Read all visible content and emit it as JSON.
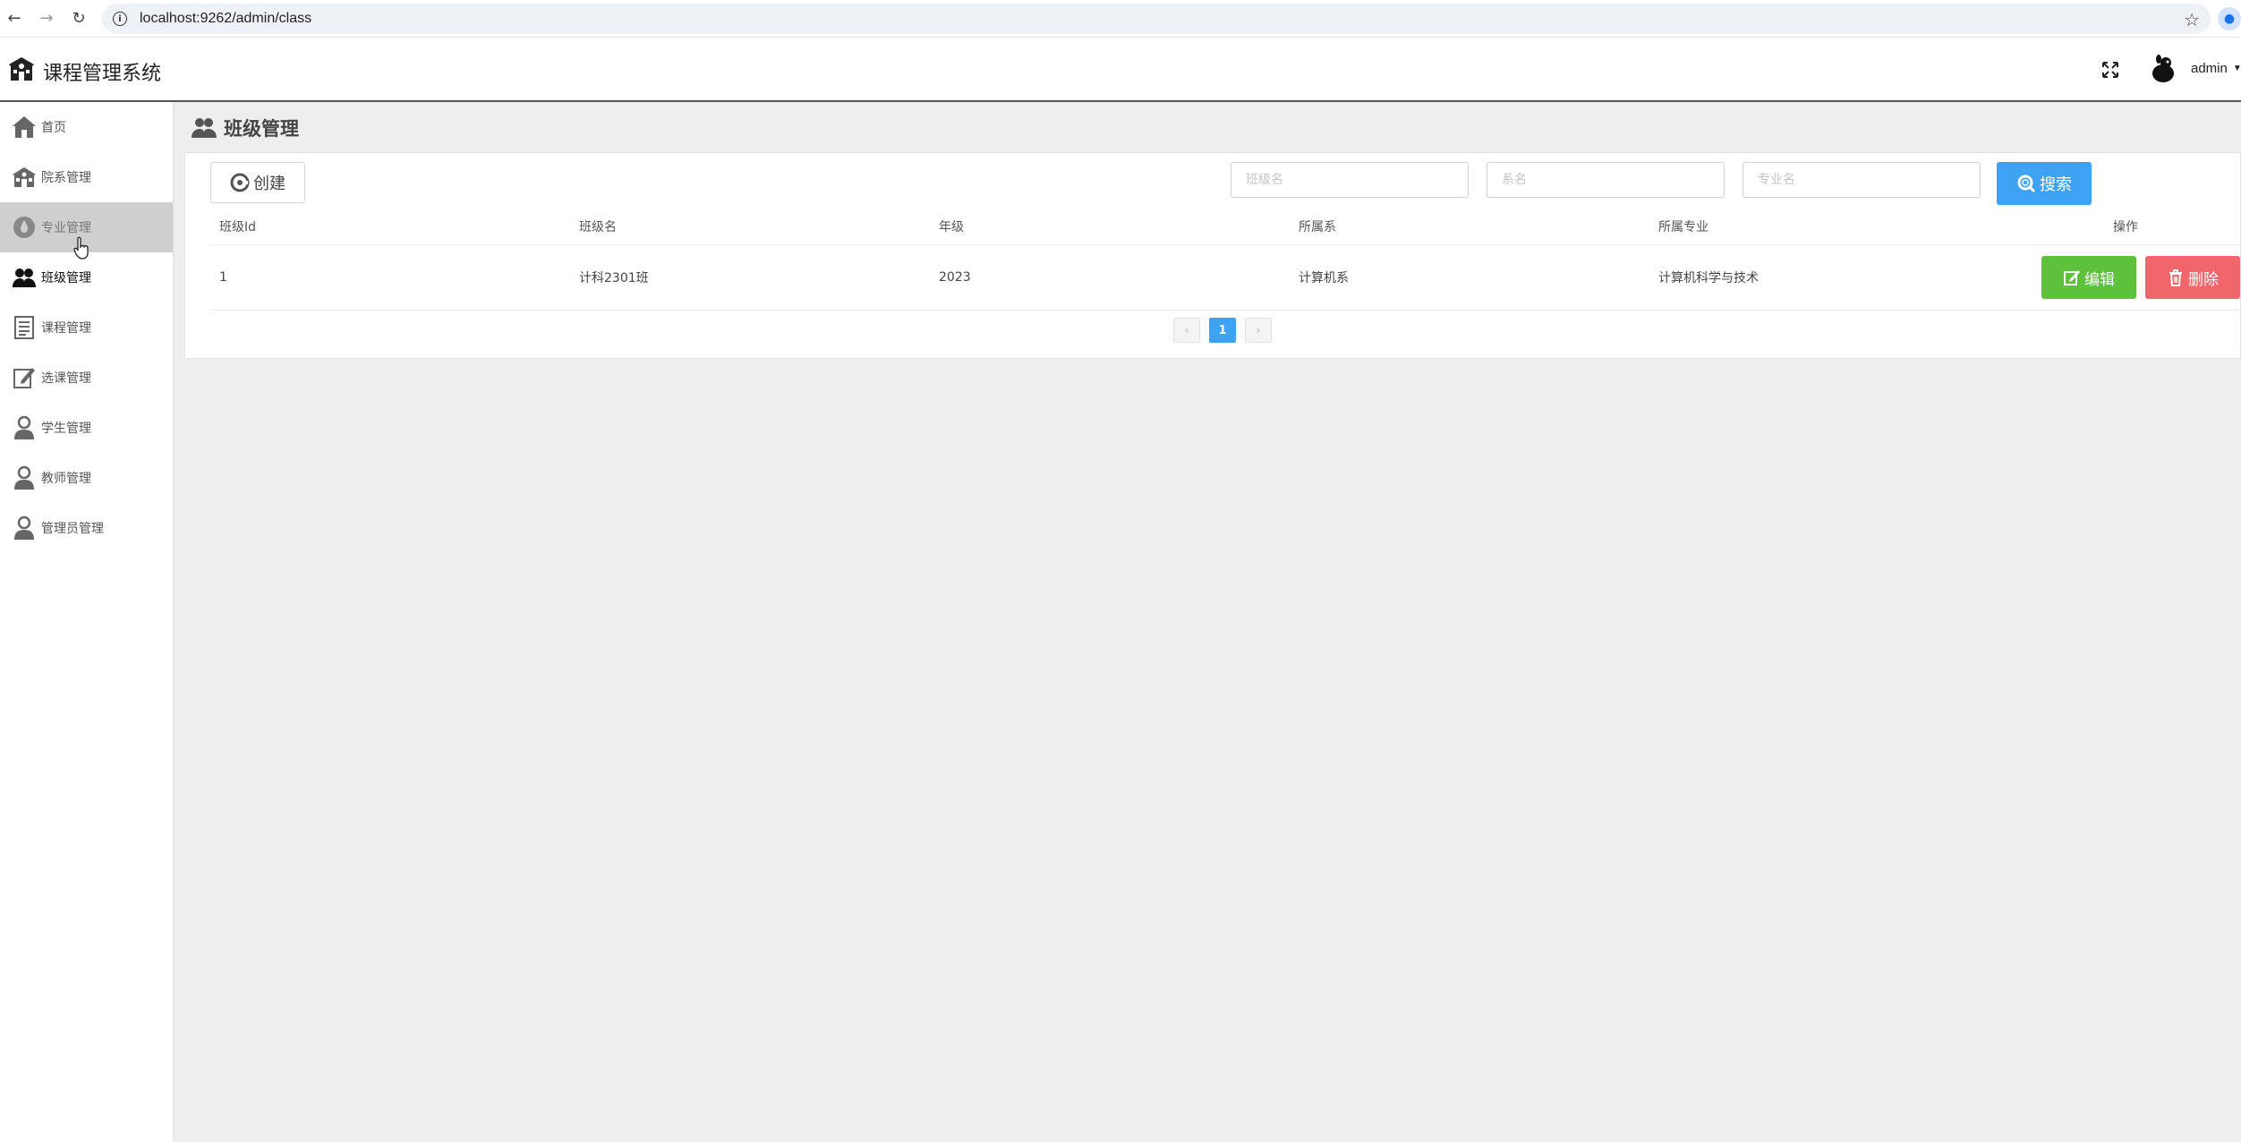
{
  "browser": {
    "url": "localhost:9262/admin/class"
  },
  "header": {
    "title": "课程管理系统",
    "user": "admin"
  },
  "sidebar": {
    "items": [
      {
        "label": "首页"
      },
      {
        "label": "院系管理"
      },
      {
        "label": "专业管理"
      },
      {
        "label": "班级管理"
      },
      {
        "label": "课程管理"
      },
      {
        "label": "选课管理"
      },
      {
        "label": "学生管理"
      },
      {
        "label": "教师管理"
      },
      {
        "label": "管理员管理"
      }
    ]
  },
  "page": {
    "title": "班级管理",
    "create_label": "创建",
    "search_label": "搜索",
    "filters": {
      "class_placeholder": "班级名",
      "dept_placeholder": "系名",
      "major_placeholder": "专业名"
    }
  },
  "table": {
    "headers": [
      "班级Id",
      "班级名",
      "年级",
      "所属系",
      "所属专业",
      "操作"
    ],
    "rows": [
      {
        "id": "1",
        "name": "计科2301班",
        "grade": "2023",
        "dept": "计算机系",
        "major": "计算机科学与技术"
      }
    ],
    "edit_label": "编辑",
    "delete_label": "删除"
  },
  "pagination": {
    "prev": "‹",
    "current": "1",
    "next": "›"
  },
  "colors": {
    "primary": "#3ea2f2",
    "success": "#5ec13b",
    "danger": "#f0666b"
  }
}
